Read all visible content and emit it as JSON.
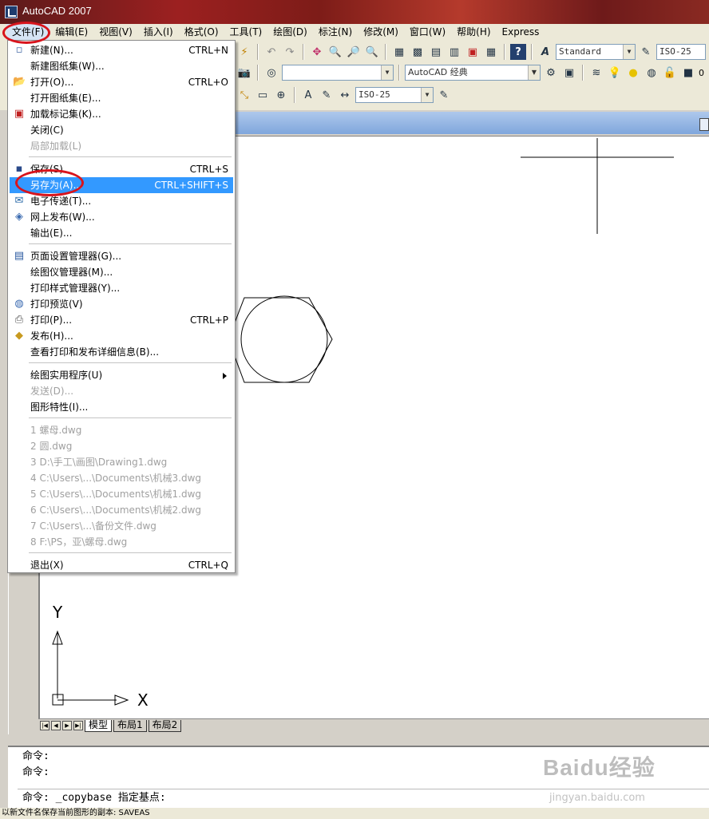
{
  "window": {
    "title": "AutoCAD 2007"
  },
  "menubar": [
    "文件(F)",
    "编辑(E)",
    "视图(V)",
    "插入(I)",
    "格式(O)",
    "工具(T)",
    "绘图(D)",
    "标注(N)",
    "修改(M)",
    "窗口(W)",
    "帮助(H)",
    "Express"
  ],
  "toolbars": {
    "text_style": "Standard",
    "dim_style": "ISO-25",
    "workspace": "AutoCAD 经典",
    "dim_style2": "ISO-25",
    "layer_value": "0"
  },
  "file_menu": {
    "items": [
      {
        "label": "新建(N)...",
        "shortcut": "CTRL+N"
      },
      {
        "label": "新建图纸集(W)...",
        "shortcut": ""
      },
      {
        "label": "打开(O)...",
        "shortcut": "CTRL+O"
      },
      {
        "label": "打开图纸集(E)...",
        "shortcut": ""
      },
      {
        "label": "加载标记集(K)...",
        "shortcut": ""
      },
      {
        "label": "关闭(C)",
        "shortcut": ""
      },
      {
        "label": "局部加载(L)",
        "shortcut": ""
      },
      {
        "label": "保存(S)",
        "shortcut": "CTRL+S"
      },
      {
        "label": "另存为(A)...",
        "shortcut": "CTRL+SHIFT+S"
      },
      {
        "label": "电子传递(T)...",
        "shortcut": ""
      },
      {
        "label": "网上发布(W)...",
        "shortcut": ""
      },
      {
        "label": "输出(E)...",
        "shortcut": ""
      },
      {
        "label": "页面设置管理器(G)...",
        "shortcut": ""
      },
      {
        "label": "绘图仪管理器(M)...",
        "shortcut": ""
      },
      {
        "label": "打印样式管理器(Y)...",
        "shortcut": ""
      },
      {
        "label": "打印预览(V)",
        "shortcut": ""
      },
      {
        "label": "打印(P)...",
        "shortcut": "CTRL+P"
      },
      {
        "label": "发布(H)...",
        "shortcut": ""
      },
      {
        "label": "查看打印和发布详细信息(B)...",
        "shortcut": ""
      },
      {
        "label": "绘图实用程序(U)",
        "shortcut": ""
      },
      {
        "label": "发送(D)...",
        "shortcut": ""
      },
      {
        "label": "图形特性(I)...",
        "shortcut": ""
      },
      {
        "label": "1 螺母.dwg",
        "shortcut": ""
      },
      {
        "label": "2 圆.dwg",
        "shortcut": ""
      },
      {
        "label": "3 D:\\手工\\画图\\Drawing1.dwg",
        "shortcut": ""
      },
      {
        "label": "4 C:\\Users\\...\\Documents\\机械3.dwg",
        "shortcut": ""
      },
      {
        "label": "5 C:\\Users\\...\\Documents\\机械1.dwg",
        "shortcut": ""
      },
      {
        "label": "6 C:\\Users\\...\\Documents\\机械2.dwg",
        "shortcut": ""
      },
      {
        "label": "7 C:\\Users\\...\\备份文件.dwg",
        "shortcut": ""
      },
      {
        "label": "8 F:\\PS，亚\\螺母.dwg",
        "shortcut": ""
      },
      {
        "label": "退出(X)",
        "shortcut": "CTRL+Q"
      }
    ]
  },
  "canvas": {
    "axis_y": "Y",
    "axis_x": "X"
  },
  "layout_tabs": [
    "模型",
    "布局1",
    "布局2"
  ],
  "command": {
    "line1": "命令:",
    "line2": "命令:",
    "line3": "命令: _copybase 指定基点:"
  },
  "status": "以新文件名保存当前图形的副本:  SAVEAS",
  "watermark": {
    "main": "Baidu经验",
    "sub": "jingyan.baidu.com"
  }
}
